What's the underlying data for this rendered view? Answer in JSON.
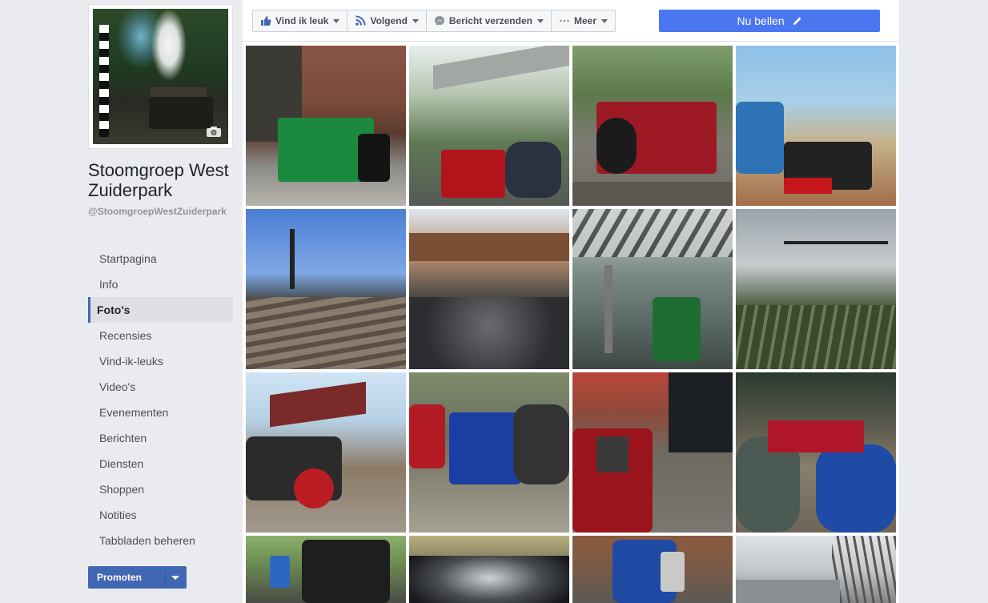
{
  "page": {
    "name": "Stoomgroep West Zuiderpark",
    "handle": "@StoomgroepWestZuiderpark"
  },
  "nav": {
    "items": [
      {
        "label": "Startpagina",
        "active": false
      },
      {
        "label": "Info",
        "active": false
      },
      {
        "label": "Foto's",
        "active": true
      },
      {
        "label": "Recensies",
        "active": false
      },
      {
        "label": "Vind-ik-leuks",
        "active": false
      },
      {
        "label": "Video's",
        "active": false
      },
      {
        "label": "Evenementen",
        "active": false
      },
      {
        "label": "Berichten",
        "active": false
      },
      {
        "label": "Diensten",
        "active": false
      },
      {
        "label": "Shoppen",
        "active": false
      },
      {
        "label": "Notities",
        "active": false
      },
      {
        "label": "Tabbladen beheren",
        "active": false
      }
    ],
    "promote_label": "Promoten"
  },
  "actionbar": {
    "like_label": "Vind ik leuk",
    "follow_label": "Volgend",
    "message_label": "Bericht verzenden",
    "more_label": "Meer",
    "call_label": "Nu bellen"
  },
  "colors": {
    "brand": "#4267b2",
    "call_button": "#4a76f0",
    "background": "#e9ebee"
  },
  "photos": [
    {
      "theme": "green-locomotive-shed"
    },
    {
      "theme": "red-locomotive-pergola"
    },
    {
      "theme": "red-locomotive-garden"
    },
    {
      "theme": "man-kneeling-track"
    },
    {
      "theme": "signals-tracks"
    },
    {
      "theme": "ballast-stones"
    },
    {
      "theme": "station-platform-green-loco"
    },
    {
      "theme": "semaphore-signals"
    },
    {
      "theme": "traction-engine"
    },
    {
      "theme": "blue-locomotive"
    },
    {
      "theme": "red-loco-shed"
    },
    {
      "theme": "children-on-train"
    },
    {
      "theme": "loco-with-bucket"
    },
    {
      "theme": "black-boiler-top"
    },
    {
      "theme": "blue-boiler"
    },
    {
      "theme": "bare-trees-sky"
    }
  ]
}
